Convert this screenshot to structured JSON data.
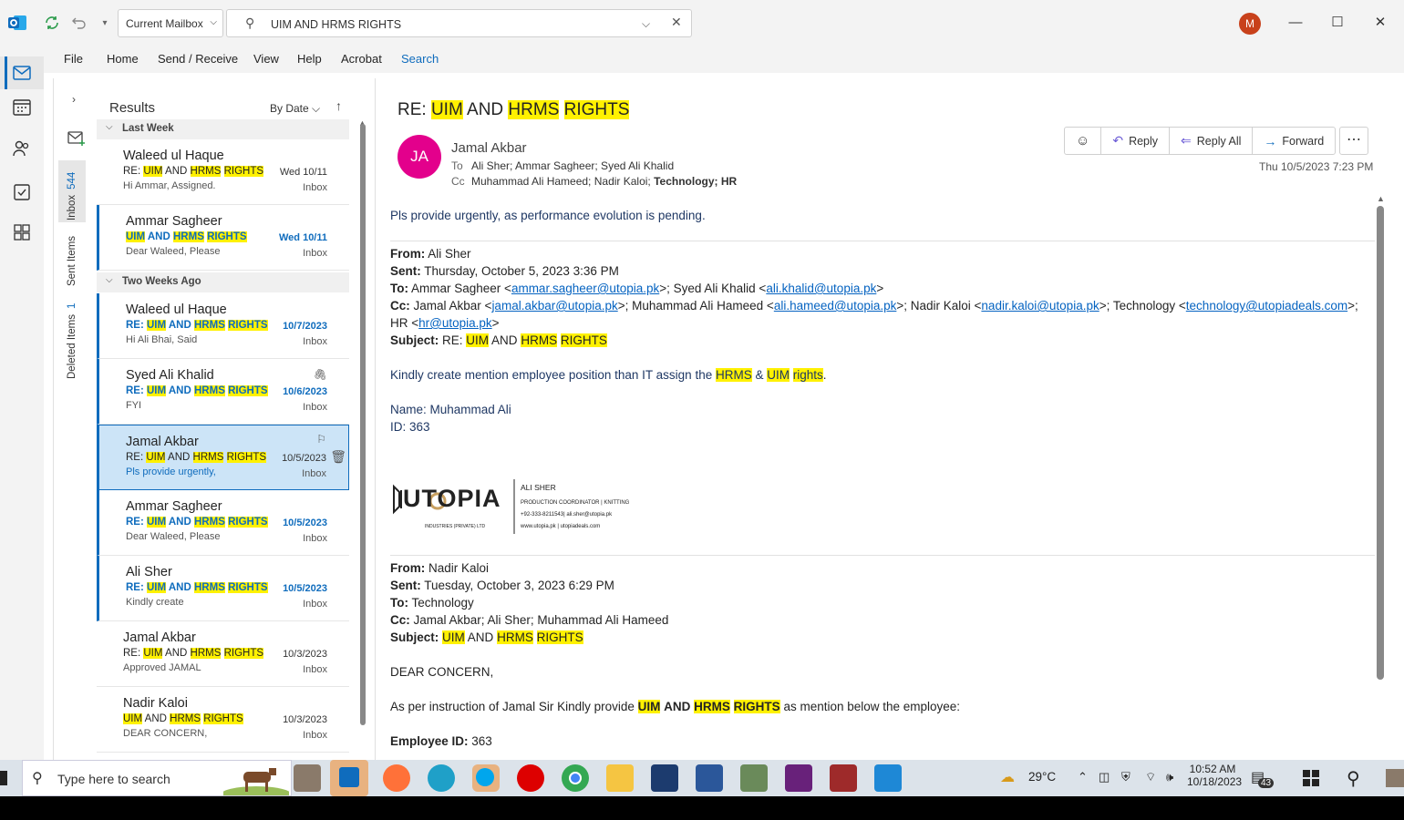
{
  "titlebar": {
    "mailbox_scope": "Current Mailbox",
    "search_query": "UIM AND HRMS RIGHTS",
    "user_initial": "M"
  },
  "menu": [
    "File",
    "Home",
    "Send / Receive",
    "View",
    "Help",
    "Acrobat",
    "Search"
  ],
  "folders": {
    "inbox": "Inbox",
    "inbox_count": "544",
    "sent": "Sent Items",
    "deleted": "Deleted Items",
    "deleted_count": "1"
  },
  "list": {
    "title": "Results",
    "sort": "By Date",
    "groups": [
      "Last Week",
      "Two Weeks Ago"
    ],
    "items": [
      {
        "sender": "Waleed ul Haque",
        "subject_prefix": "RE: ",
        "preview": "Hi Ammar,  Assigned.",
        "date": "Wed 10/11",
        "folder": "Inbox"
      },
      {
        "sender": "Ammar Sagheer",
        "subject_prefix": "",
        "preview": "Dear Waleed,  Please",
        "date": "Wed 10/11",
        "folder": "Inbox"
      },
      {
        "sender": "Waleed ul Haque",
        "subject_prefix": "RE: ",
        "preview": "Hi Ali Bhai,  Said",
        "date": "10/7/2023",
        "folder": "Inbox"
      },
      {
        "sender": "Syed Ali Khalid",
        "subject_prefix": "RE: ",
        "preview": "FYI",
        "date": "10/6/2023",
        "folder": "Inbox"
      },
      {
        "sender": "Jamal Akbar",
        "subject_prefix": "RE: ",
        "preview": "Pls provide urgently,",
        "date": "10/5/2023",
        "folder": "Inbox"
      },
      {
        "sender": "Ammar Sagheer",
        "subject_prefix": "RE: ",
        "preview": "Dear Waleed,  Please",
        "date": "10/5/2023",
        "folder": "Inbox"
      },
      {
        "sender": "Ali Sher",
        "subject_prefix": "RE: ",
        "preview": "Kindly create",
        "date": "10/5/2023",
        "folder": "Inbox"
      },
      {
        "sender": "Jamal Akbar",
        "subject_prefix": "RE: ",
        "preview": "Approved   JAMAL",
        "date": "10/3/2023",
        "folder": "Inbox"
      },
      {
        "sender": "Nadir Kaloi",
        "subject_prefix": "",
        "preview": "DEAR CONCERN,",
        "date": "10/3/2023",
        "folder": "Inbox"
      }
    ],
    "kw": {
      "uim": "UIM",
      "and": "AND",
      "hrms": "HRMS",
      "rights": "RIGHTS"
    }
  },
  "reading": {
    "subject_prefix": "RE: ",
    "avatar": "JA",
    "from": "Jamal Akbar",
    "to_label": "To",
    "to": "Ali Sher; Ammar Sagheer; Syed Ali Khalid",
    "cc_label": "Cc",
    "cc": "Muhammad Ali Hameed; Nadir Kaloi; ",
    "cc_bold": "Technology; HR",
    "date": "Thu 10/5/2023 7:23 PM",
    "actions": {
      "reply": "Reply",
      "reply_all": "Reply All",
      "forward": "Forward"
    },
    "body1": "Pls provide urgently, as performance evolution is pending.",
    "msg1": {
      "from_l": "From:",
      "from": " Ali Sher",
      "sent_l": "Sent:",
      "sent": " Thursday, October 5, 2023 3:36 PM",
      "to_l": "To:",
      "cc_l": "Cc:",
      "subj_l": "Subject:",
      "subj_pre": " RE: "
    },
    "emails": {
      "ammar": "ammar.sagheer@utopia.pk",
      "ali": "ali.khalid@utopia.pk",
      "jamal": "jamal.akbar@utopia.pk",
      "hameed": "ali.hameed@utopia.pk",
      "nadir": "nadir.kaloi@utopia.pk",
      "tech": "technology@utopiadeals.com",
      "hr": "hr@utopia.pk"
    },
    "kindly_pre": "Kindly create mention employee position than IT assign the ",
    "kindly_amp": " & ",
    "kindly_end": ".",
    "hl_rights": "rights",
    "name_line": "Name: Muhammad Ali",
    "id_line": "ID: 363",
    "sig": {
      "brand": "UTOPIA",
      "sub": "INDUSTRIES (PRIVATE) LTD",
      "name": "ALI SHER",
      "role": "PRODUCTION COORDINATOR | KNITTING",
      "phone": "+92-333-8211543| ali.sher@utopia.pk",
      "web": "www.utopia.pk | utopiadeals.com"
    },
    "msg2": {
      "from": " Nadir Kaloi",
      "sent": " Tuesday, October 3, 2023 6:29 PM",
      "to": " Technology",
      "cc": " Jamal Akbar; Ali Sher; Muhammad Ali Hameed"
    },
    "dear": "DEAR CONCERN,",
    "per_pre": "As per instruction of Jamal Sir Kindly provide ",
    "per_end": " as mention below the employee:",
    "emp_l": "Employee ID:",
    "emp": " 363"
  },
  "taskbar": {
    "search": "Type here to search",
    "weather": "29°C",
    "time": "10:52 AM",
    "date": "10/18/2023",
    "notif": "43"
  }
}
